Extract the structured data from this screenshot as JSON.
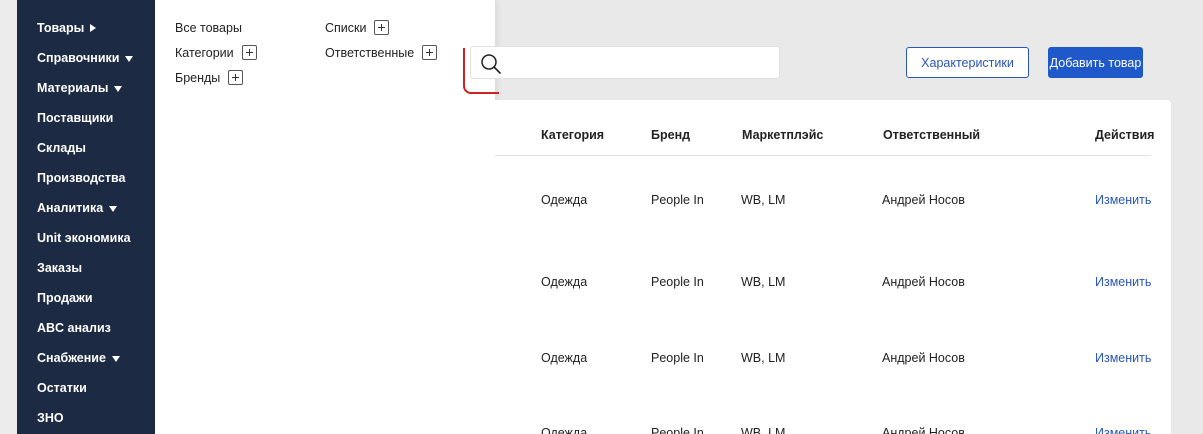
{
  "sidebar": {
    "items": [
      {
        "label": "Товары",
        "arrow": "right"
      },
      {
        "label": "Справочники",
        "arrow": "down"
      },
      {
        "label": "Материалы",
        "arrow": "down"
      },
      {
        "label": "Поставщики"
      },
      {
        "label": "Склады"
      },
      {
        "label": "Производства"
      },
      {
        "label": "Аналитика",
        "arrow": "down"
      },
      {
        "label": "Unit экономика"
      },
      {
        "label": "Заказы"
      },
      {
        "label": "Продажи"
      },
      {
        "label": "ABC анализ"
      },
      {
        "label": "Снабжение",
        "arrow": "down"
      },
      {
        "label": "Остатки"
      },
      {
        "label": "ЗНО"
      }
    ]
  },
  "dropdown": {
    "col1": [
      {
        "label": "Все товары",
        "has_plus": false
      },
      {
        "label": "Категории",
        "has_plus": true
      },
      {
        "label": "Бренды",
        "has_plus": true
      }
    ],
    "col2": [
      {
        "label": "Списки",
        "has_plus": true
      },
      {
        "label": "Ответственные",
        "has_plus": true
      }
    ]
  },
  "search": {
    "placeholder": "",
    "icon": "search-icon"
  },
  "buttons": {
    "characteristics": "Характеристики",
    "add_product": "Добавить товар"
  },
  "colors": {
    "accent": "#1f58c9",
    "sidebar_bg": "#1d2a44",
    "marker": "#cc2222"
  },
  "table": {
    "headers": {
      "category": "Категория",
      "brand": "Бренд",
      "marketplace": "Маркетплэйс",
      "responsible": "Ответственный",
      "actions": "Действия"
    },
    "rows": [
      {
        "category": "Одежда",
        "brand": "People In",
        "marketplace": "WB, LM",
        "responsible": "Андрей Носов",
        "action": "Изменить"
      },
      {
        "category": "Одежда",
        "brand": "People In",
        "marketplace": "WB, LM",
        "responsible": "Андрей Носов",
        "action": "Изменить"
      },
      {
        "category": "Одежда",
        "brand": "People In",
        "marketplace": "WB, LM",
        "responsible": "Андрей Носов",
        "action": "Изменить"
      },
      {
        "category": "Одежда",
        "brand": "People In",
        "marketplace": "WB, LM",
        "responsible": "Андрей Носов",
        "action": "Изменить"
      }
    ]
  }
}
